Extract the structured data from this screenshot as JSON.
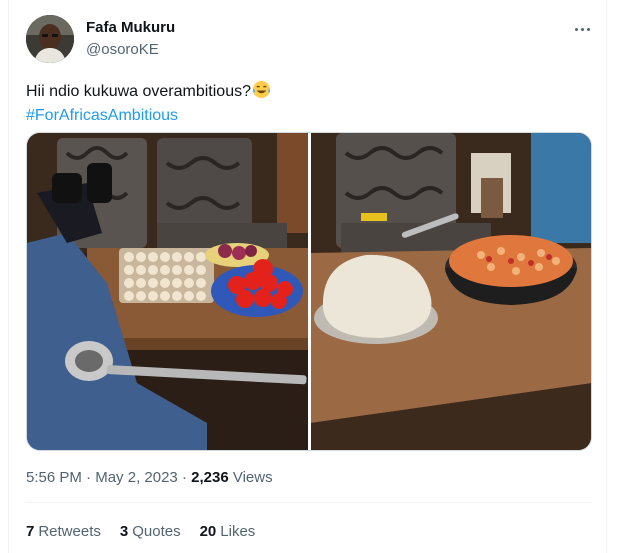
{
  "author": {
    "name": "Fafa Mukuru",
    "handle": "@osoroKE"
  },
  "tweet": {
    "text": "Hii ndio kukuwa overambitious?",
    "emoji": "face-with-tears-of-joy",
    "hashtag": "#ForAfricasAmbitious"
  },
  "meta": {
    "time": "5:56 PM",
    "separator": "·",
    "date": "May 2, 2023",
    "views_count": "2,236",
    "views_label": "Views"
  },
  "stats": {
    "retweets_count": "7",
    "retweets_label": "Retweets",
    "quotes_count": "3",
    "quotes_label": "Quotes",
    "likes_count": "20",
    "likes_label": "Likes"
  },
  "colors": {
    "link": "#1d9bf0",
    "secondary_text": "#536471",
    "primary_text": "#0f1419"
  }
}
